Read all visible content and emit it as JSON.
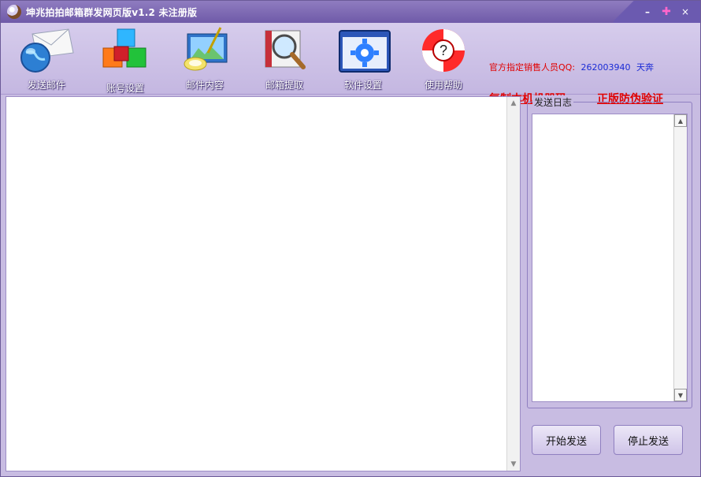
{
  "window": {
    "title": "坤兆拍拍邮箱群发网页版v1.2  未注册版"
  },
  "titlebar": {
    "minimize": "–",
    "maximize": "✚",
    "close": "×"
  },
  "toolbar": {
    "items": [
      {
        "label": "发送邮件",
        "icon": "envelope-globe-icon"
      },
      {
        "label": "账号设置",
        "icon": "cubes-icon"
      },
      {
        "label": "邮件内容",
        "icon": "paint-palette-icon"
      },
      {
        "label": "邮箱提取",
        "icon": "book-magnifier-icon"
      },
      {
        "label": "软件设置",
        "icon": "gear-window-icon"
      },
      {
        "label": "使用帮助",
        "icon": "lifebuoy-help-icon"
      }
    ]
  },
  "promo": {
    "label": "官方指定销售人员QQ:",
    "qq": "262003940",
    "name": "天奔",
    "copy_machine_code": "复制本机机器码",
    "anti_fake": "正版防伪验证"
  },
  "log": {
    "title": "发送日志"
  },
  "actions": {
    "start": "开始发送",
    "stop": "停止发送"
  },
  "colors": {
    "accent": "#6f5aa8",
    "promo_red": "#e10000",
    "qq_blue": "#1a2bd6"
  }
}
